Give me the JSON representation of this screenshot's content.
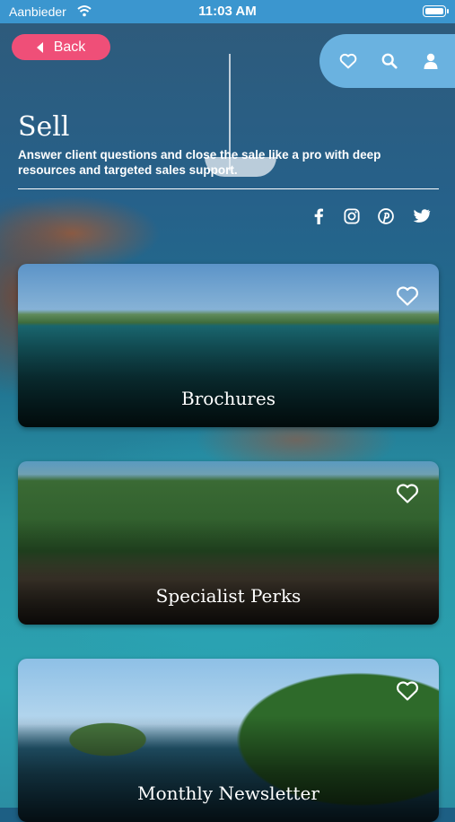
{
  "status_bar": {
    "carrier": "Aanbieder",
    "time": "11:03 AM"
  },
  "nav": {
    "back_label": "Back"
  },
  "header": {
    "title": "Sell",
    "subtitle": "Answer client questions and close the sale like a pro with deep resources and targeted sales support."
  },
  "top_actions": [
    "heart-icon",
    "search-icon",
    "user-icon"
  ],
  "social": [
    "facebook-icon",
    "instagram-icon",
    "pinterest-icon",
    "twitter-icon"
  ],
  "cards": [
    {
      "title": "Brochures"
    },
    {
      "title": "Specialist Perks"
    },
    {
      "title": "Monthly Newsletter"
    }
  ],
  "colors": {
    "back_button": "#ef4f78",
    "action_bar": "#6ab2e0",
    "status_bar": "#3b96cf"
  }
}
